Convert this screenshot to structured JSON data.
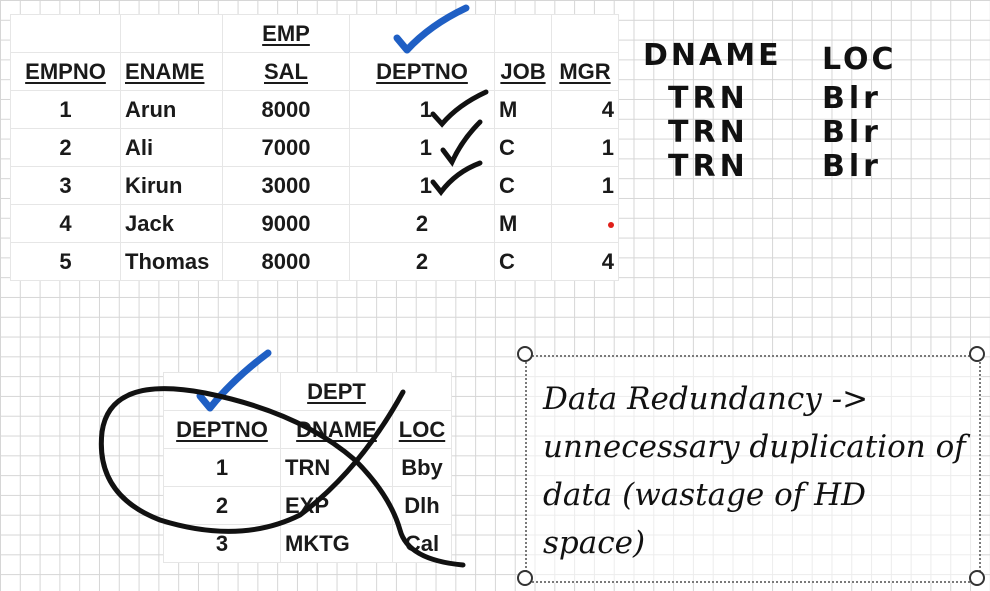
{
  "emp": {
    "title": "EMP",
    "headers": [
      "EMPNO",
      "ENAME",
      "SAL",
      "DEPTNO",
      "JOB",
      "MGR"
    ],
    "rows": [
      [
        "1",
        "Arun",
        "8000",
        "1",
        "M",
        "4"
      ],
      [
        "2",
        "Ali",
        "7000",
        "1",
        "C",
        "1"
      ],
      [
        "3",
        "Kirun",
        "3000",
        "1",
        "C",
        "1"
      ],
      [
        "4",
        "Jack",
        "9000",
        "2",
        "M",
        ""
      ],
      [
        "5",
        "Thomas",
        "8000",
        "2",
        "C",
        "4"
      ]
    ]
  },
  "dept": {
    "title": "DEPT",
    "headers": [
      "DEPTNO",
      "DNAME",
      "LOC"
    ],
    "rows": [
      [
        "1",
        "TRN",
        "Bby"
      ],
      [
        "2",
        "EXP",
        "Dlh"
      ],
      [
        "3",
        "MKTG",
        "Cal"
      ]
    ]
  },
  "handwriting": {
    "dname_header": "DNAME",
    "loc_header": "LOC",
    "dname_values": [
      "TRN",
      "TRN",
      "TRN"
    ],
    "loc_values": [
      "Blr",
      "Blr",
      "Blr"
    ]
  },
  "note": {
    "text": "Data Redundancy -> unnecessary duplication of data (wastage of HD space)"
  },
  "colors": {
    "blue_check": "#1f5fc4",
    "ink": "#111111",
    "red_dot": "#e0201a"
  }
}
